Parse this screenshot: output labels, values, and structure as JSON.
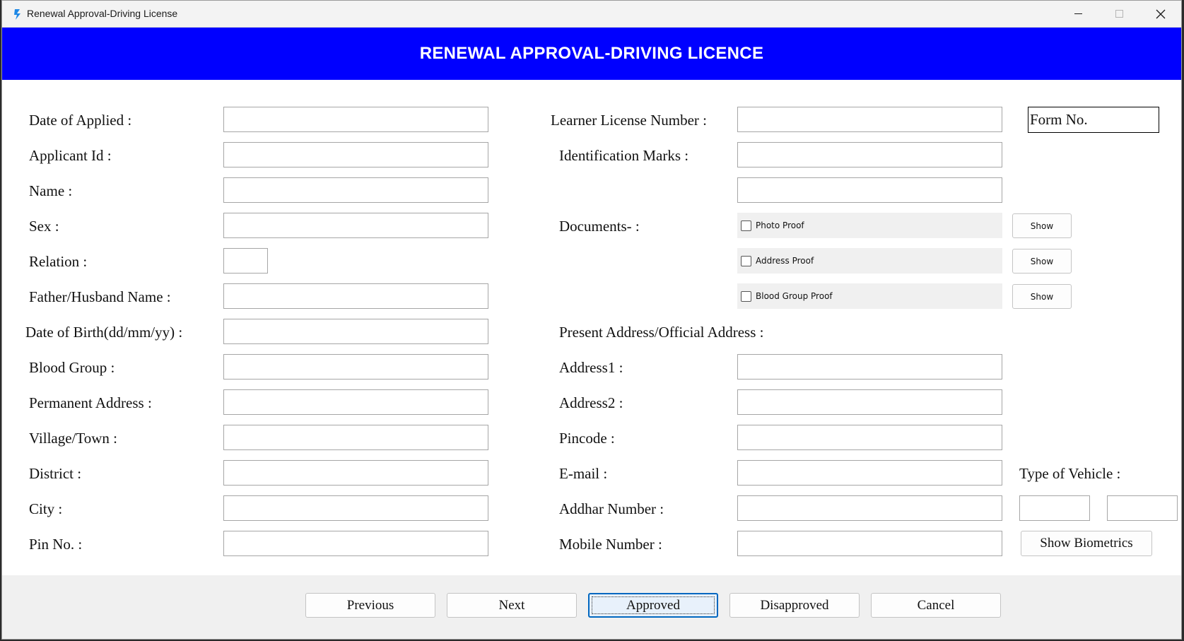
{
  "window": {
    "title": "Renewal Approval-Driving License"
  },
  "banner": {
    "title": "RENEWAL APPROVAL-DRIVING LICENCE"
  },
  "left_fields": [
    {
      "label": "Date of Applied :",
      "value": ""
    },
    {
      "label": "Applicant Id :",
      "value": ""
    },
    {
      "label": "Name :",
      "value": ""
    },
    {
      "label": "Sex :",
      "value": ""
    },
    {
      "label": "Relation :",
      "value": ""
    },
    {
      "label": "Father/Husband Name :",
      "value": ""
    },
    {
      "label": "Date of Birth(dd/mm/yy) :",
      "value": ""
    },
    {
      "label": "Blood Group :",
      "value": ""
    },
    {
      "label": "Permanent Address :",
      "value": ""
    },
    {
      "label": "Village/Town :",
      "value": ""
    },
    {
      "label": "District :",
      "value": ""
    },
    {
      "label": "City :",
      "value": ""
    },
    {
      "label": "Pin No. :",
      "value": ""
    }
  ],
  "right": {
    "learner_label": "Learner License Number :",
    "identification_label": "Identification Marks :",
    "documents_label": "Documents- :",
    "documents": [
      {
        "label": "Photo Proof",
        "checked": false,
        "button": "Show"
      },
      {
        "label": "Address Proof",
        "checked": false,
        "button": "Show"
      },
      {
        "label": "Blood Group Proof",
        "checked": false,
        "button": "Show"
      }
    ],
    "present_address_label": "Present Address/Official Address :",
    "address1_label": "Address1 :",
    "address2_label": "Address2 :",
    "pincode_label": "Pincode :",
    "email_label": "E-mail :",
    "aadhar_label": "Addhar Number :",
    "mobile_label": "Mobile Number :",
    "form_no": "Form No.",
    "vehicle_label": "Type of Vehicle :",
    "biometrics_button": "Show Biometrics"
  },
  "footer": {
    "previous": "Previous",
    "next": "Next",
    "approved": "Approved",
    "disapproved": "Disapproved",
    "cancel": "Cancel"
  }
}
